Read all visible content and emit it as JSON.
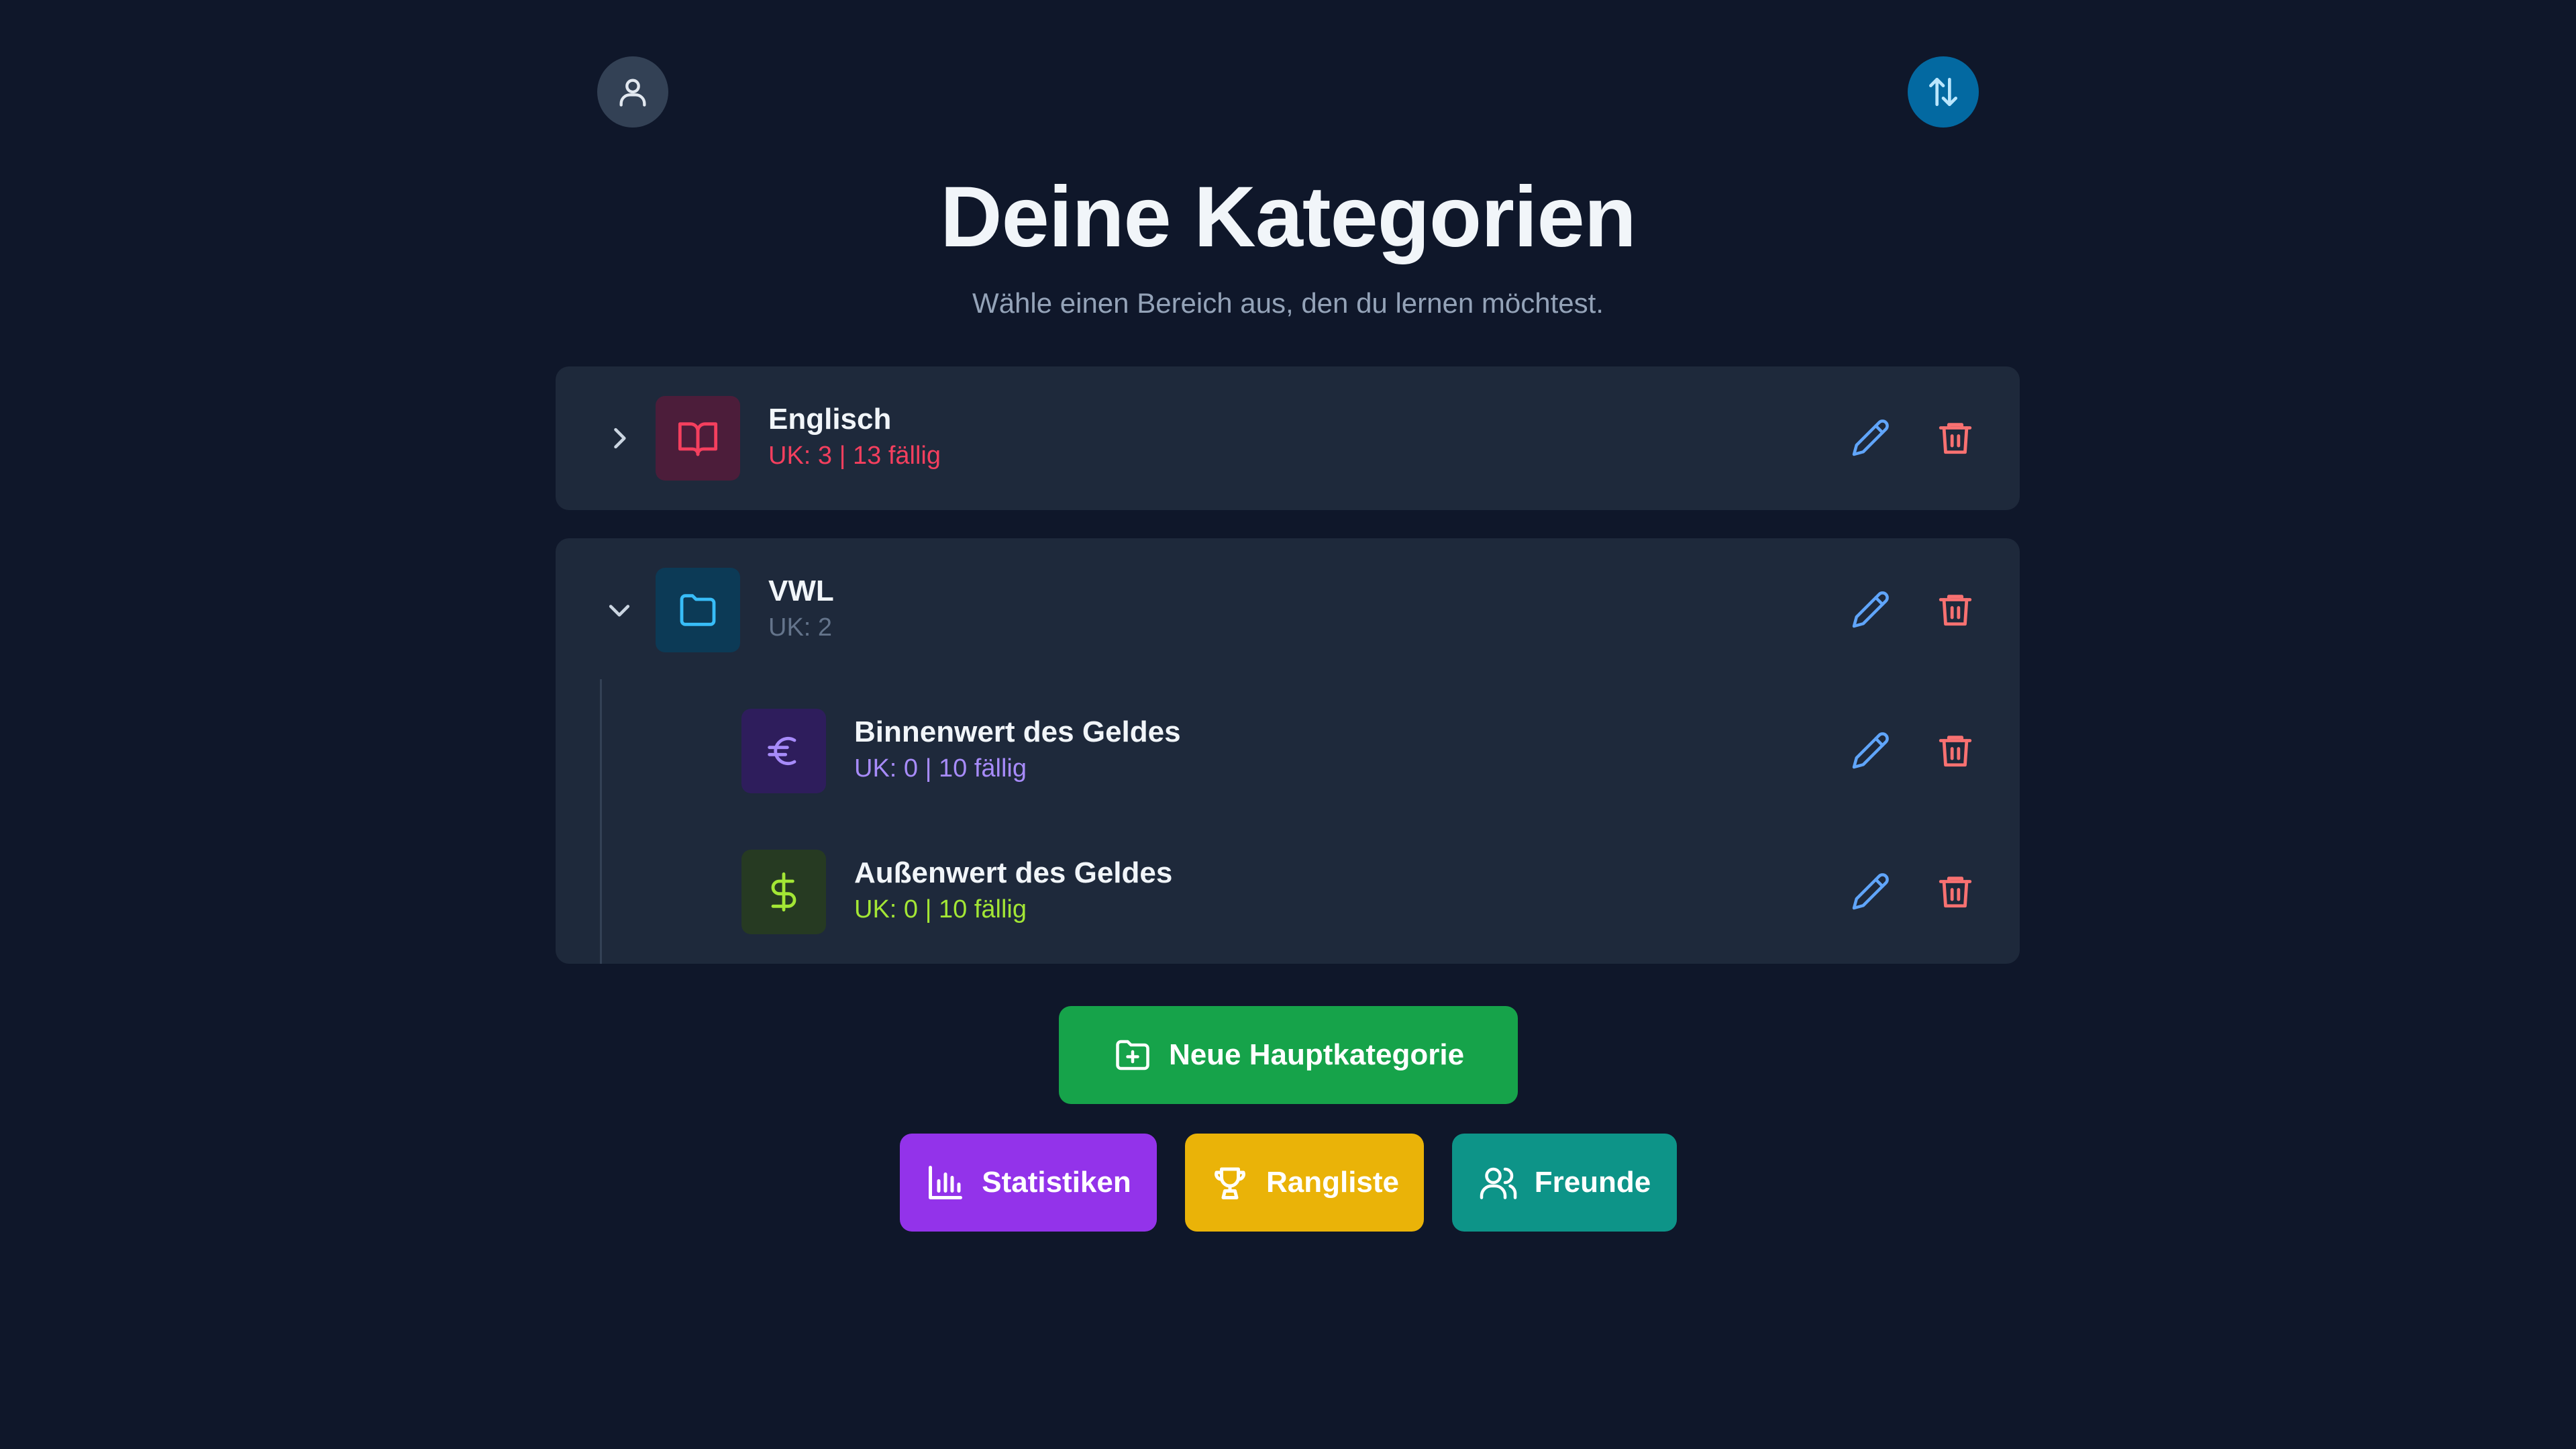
{
  "header": {
    "title": "Deine Kategorien",
    "subtitle": "Wähle einen Bereich aus, den du lernen möchtest."
  },
  "top_buttons": {
    "profile_icon": "user-icon",
    "sort_icon": "sort-arrows-icon"
  },
  "categories": [
    {
      "name": "Englisch",
      "meta": "UK: 3 | 13 fällig",
      "icon": "book-open-icon",
      "color": "#f43f5e",
      "expanded": false
    },
    {
      "name": "VWL",
      "meta": "UK: 2",
      "icon": "folder-icon",
      "color": "#38bdf8",
      "expanded": true,
      "subcategories": [
        {
          "name": "Binnenwert des Geldes",
          "meta": "UK: 0 | 10 fällig",
          "icon": "euro-icon",
          "color": "#a78bfa"
        },
        {
          "name": "Außenwert des Geldes",
          "meta": "UK: 0 | 10 fällig",
          "icon": "dollar-icon",
          "color": "#a3e635"
        }
      ]
    }
  ],
  "actions": {
    "new_category": "Neue Hauptkategorie",
    "statistics": "Statistiken",
    "leaderboard": "Rangliste",
    "friends": "Freunde"
  },
  "colors": {
    "background": "#0f172a",
    "card": "#1e293b",
    "edit": "#60a5fa",
    "delete": "#f87171",
    "green": "#16a34a",
    "purple": "#9333ea",
    "yellow": "#eab308",
    "teal": "#0d9488"
  }
}
